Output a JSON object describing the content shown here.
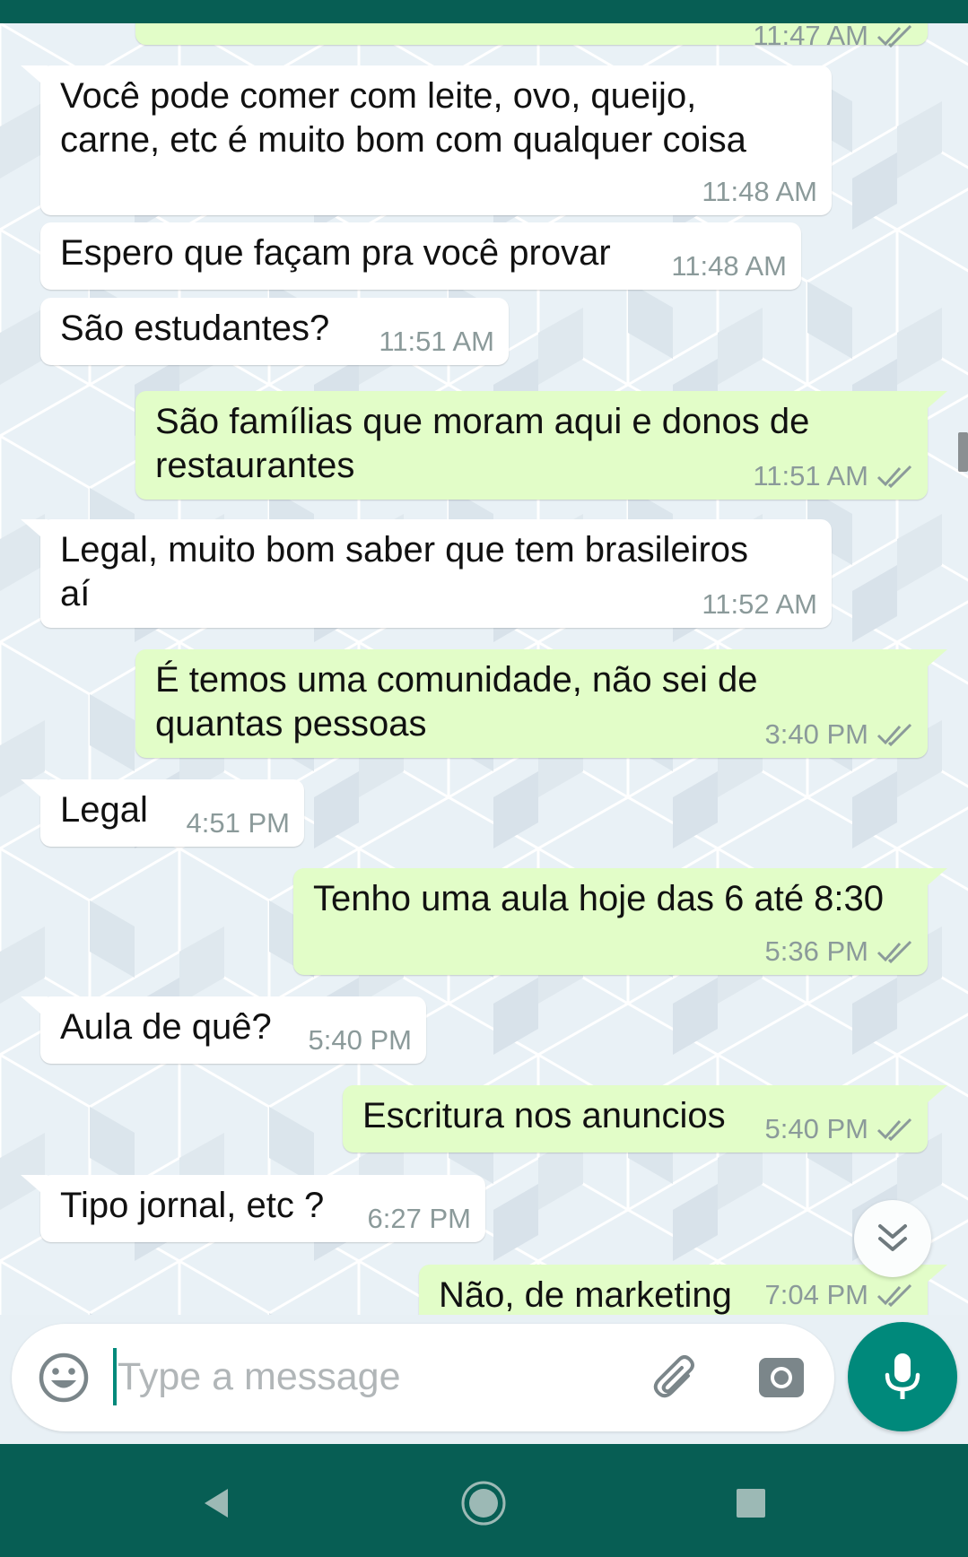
{
  "messages": [
    {
      "dir": "out",
      "text": "",
      "time": "11:47 AM",
      "ticks": true
    },
    {
      "dir": "in",
      "text": "Você pode comer com leite, ovo, queijo,\ncarne, etc é muito bom com qualquer coisa",
      "time": "11:48 AM"
    },
    {
      "dir": "in",
      "text": "Espero que façam pra você provar",
      "time": "11:48 AM"
    },
    {
      "dir": "in",
      "text": "São estudantes?",
      "time": "11:51 AM"
    },
    {
      "dir": "out",
      "text": "São famílias que moram aqui e donos de\nrestaurantes",
      "time": "11:51 AM",
      "ticks": true
    },
    {
      "dir": "in",
      "text": "Legal, muito bom saber que tem brasileiros\naí",
      "time": "11:52 AM"
    },
    {
      "dir": "out",
      "text": "É temos uma comunidade, não sei de\nquantas pessoas",
      "time": "3:40 PM",
      "ticks": true
    },
    {
      "dir": "in",
      "text": "Legal",
      "time": "4:51 PM"
    },
    {
      "dir": "out",
      "text": "Tenho uma aula hoje das 6 até 8:30",
      "time": "5:36 PM",
      "ticks": true
    },
    {
      "dir": "in",
      "text": "Aula de quê?",
      "time": "5:40 PM"
    },
    {
      "dir": "out",
      "text": "Escritura nos anuncios",
      "time": "5:40 PM",
      "ticks": true
    },
    {
      "dir": "in",
      "text": "Tipo jornal, etc ?",
      "time": "6:27 PM"
    },
    {
      "dir": "out",
      "text": "Não, de marketing",
      "time": "7:04 PM",
      "ticks": true
    }
  ],
  "composer": {
    "placeholder": "Type a message",
    "emoji_icon": "smiley-icon",
    "attach_icon": "paperclip-icon",
    "camera_icon": "camera-icon",
    "mic_icon": "microphone-icon"
  },
  "colors": {
    "header": "#075e54",
    "incoming_bubble": "#ffffff",
    "outgoing_bubble": "#e2fdc8",
    "accent": "#00897b",
    "timestamp": "#8b9a9a",
    "read_ticks": "#8b9a9a"
  },
  "nav": {
    "back_icon": "back-triangle-icon",
    "home_icon": "home-circle-icon",
    "recents_icon": "recents-square-icon"
  }
}
